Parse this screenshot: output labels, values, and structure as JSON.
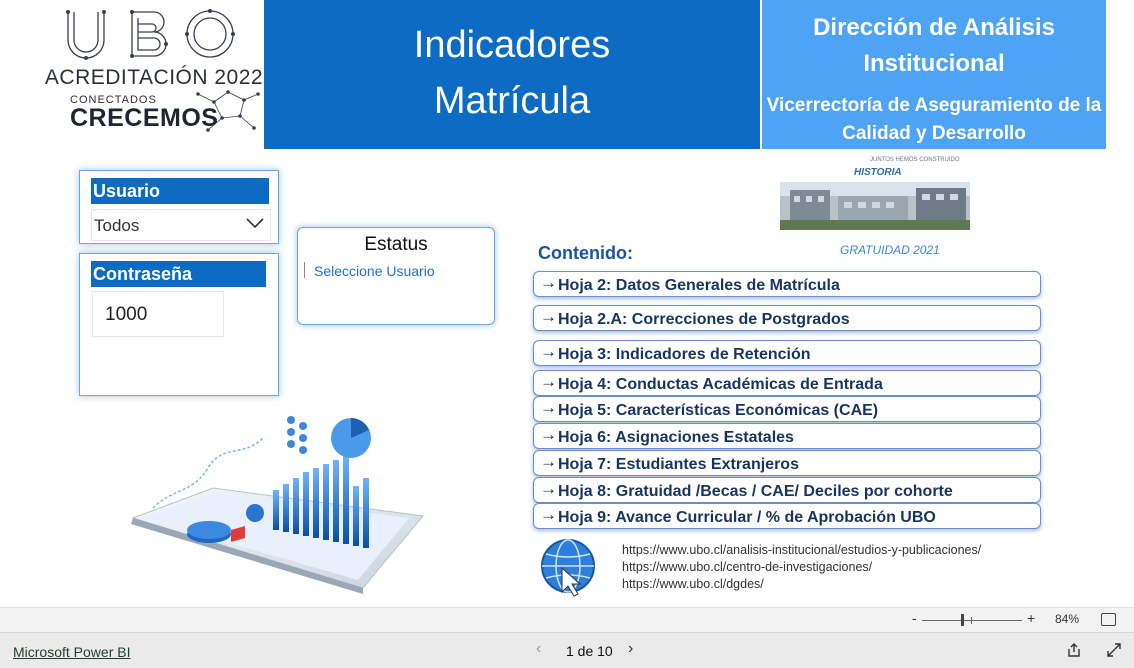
{
  "logo": {
    "ubo": "UBO",
    "acreditacion": "ACREDITACIÓN 2022",
    "conectados": "CONECTADOS",
    "crecemos": "CRECEMOS"
  },
  "header": {
    "title_line1": "Indicadores",
    "title_line2": "Matrícula",
    "right_title": "Dirección de Análisis Institucional",
    "right_subtitle": "Vicerrectoría de Aseguramiento de la Calidad y Desarrollo"
  },
  "login": {
    "user_label": "Usuario",
    "user_value": "Todos",
    "password_label": "Contraseña",
    "password_value": "1000"
  },
  "status": {
    "title": "Estatus",
    "message": "Seleccione Usuario"
  },
  "contents": {
    "heading": "Contenido:",
    "items": [
      "Hoja 2: Datos Generales de Matrícula",
      "Hoja 2.A: Correcciones de Postgrados",
      "Hoja 3: Indicadores de Retención",
      "Hoja 4: Conductas Académicas de Entrada",
      "Hoja 5: Características Económicas (CAE)",
      "Hoja 6: Asignaciones Estatales",
      "Hoja 7: Estudiantes Extranjeros",
      "Hoja 8: Gratuidad /Becas / CAE/ Deciles por cohorte",
      "Hoja 9: Avance Curricular / % de Aprobación UBO"
    ]
  },
  "photo": {
    "caption_top": "JUNTOS HEMOS CONSTRUIDO",
    "caption_main": "HISTORIA",
    "caption_bottom": "GRATUIDAD 2021"
  },
  "urls": [
    "https://www.ubo.cl/analisis-institucional/estudios-y-publicaciones/",
    "https://www.ubo.cl/centro-de-investigaciones/",
    "https://www.ubo.cl/dgdes/"
  ],
  "zoom": {
    "minus": "-",
    "plus": "+",
    "level": "84%"
  },
  "footer": {
    "brand": "Microsoft Power BI",
    "page": "1 de 10",
    "prev": "‹",
    "next": "›"
  },
  "colors": {
    "header_blue": "#0d6bc4",
    "header_light_blue": "#4ea3f4",
    "link_text": "#17355f"
  }
}
